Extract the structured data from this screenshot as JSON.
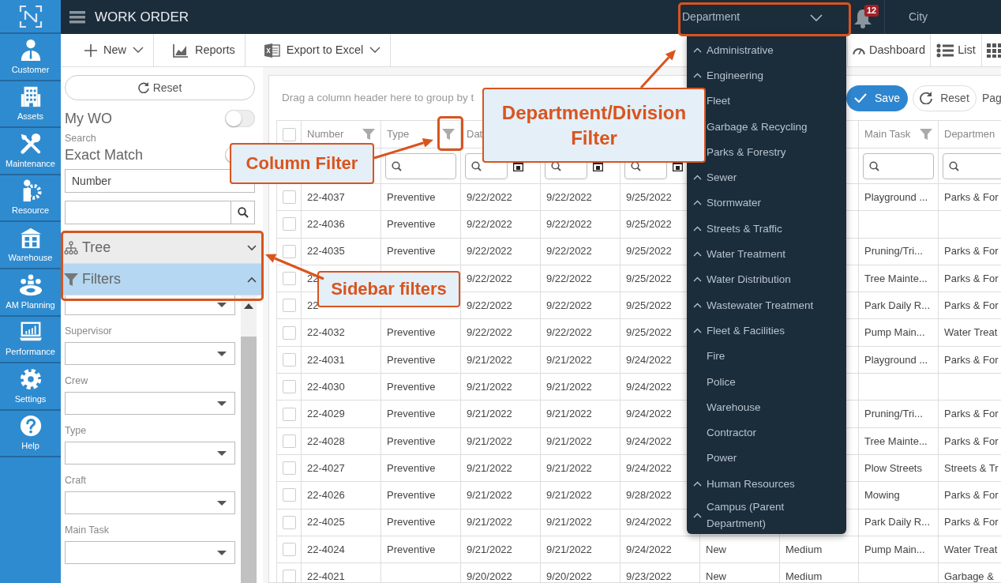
{
  "rail": {
    "items": [
      {
        "label": "Customer",
        "kind": "customer"
      },
      {
        "label": "Assets",
        "kind": "assets"
      },
      {
        "label": "Maintenance",
        "kind": "maintenance"
      },
      {
        "label": "Resource",
        "kind": "resource"
      },
      {
        "label": "Warehouse",
        "kind": "warehouse"
      },
      {
        "label": "AM Planning",
        "kind": "planning"
      },
      {
        "label": "Performance",
        "kind": "performance"
      },
      {
        "label": "Settings",
        "kind": "settings"
      },
      {
        "label": "Help",
        "kind": "help"
      }
    ]
  },
  "app_bar": {
    "title": "WORK ORDER",
    "department": {
      "label": "Department",
      "expanded": true
    },
    "notifications": "12",
    "city": "City"
  },
  "toolbar": {
    "left": [
      {
        "kind": "new",
        "label": "New",
        "caret": true
      },
      {
        "kind": "reports",
        "label": "Reports",
        "caret": false
      },
      {
        "kind": "export",
        "label": "Export to Excel",
        "caret": true
      }
    ],
    "right": [
      {
        "kind": "dashboard",
        "label": "Dashboard"
      },
      {
        "kind": "list",
        "label": "List"
      },
      {
        "kind": "grid"
      }
    ]
  },
  "sidebar": {
    "reset": "Reset",
    "my_wo": {
      "label": "My WO",
      "on": false
    },
    "search_label": "Search",
    "exact_match": {
      "label": "Exact Match",
      "on": false
    },
    "search_by": "Number",
    "sections": [
      {
        "label": "Tree",
        "kind": "tree",
        "expanded": false
      },
      {
        "label": "Filters",
        "kind": "filter",
        "expanded": true
      }
    ],
    "filters": [
      {
        "kind": "select"
      },
      {
        "kind": "select",
        "label": "Supervisor"
      },
      {
        "kind": "select",
        "label": "Crew"
      },
      {
        "kind": "select",
        "label": "Type"
      },
      {
        "kind": "select",
        "label": "Craft"
      },
      {
        "kind": "select",
        "label": "Main Task"
      }
    ]
  },
  "grid": {
    "group_hint": "Drag a column header here to group by t",
    "save": "Save",
    "reset": "Reset",
    "pager": "Pag",
    "select_all": {
      "checked": false
    },
    "columns": [
      {
        "kind": "plain",
        "label": "Number",
        "filter_icon": true
      },
      {
        "kind": "search",
        "label": "Type",
        "filter_icon": true
      },
      {
        "kind": "date",
        "label": "Dat",
        "filter_icon": false
      },
      {
        "kind": "date"
      },
      {
        "kind": "date"
      },
      {
        "kind": "plain"
      },
      {
        "kind": "plain"
      },
      {
        "kind": "search",
        "label": "Main Task",
        "filter_icon": true
      },
      {
        "kind": "search",
        "label": "Departmen",
        "filter_icon": false
      }
    ],
    "rows": [
      {
        "checked": false,
        "cells": [
          "22-4037",
          "Preventive",
          "9/22/2022",
          "9/22/2022",
          "9/25/2022",
          null,
          null,
          "Playground ...",
          "Parks & For"
        ]
      },
      {
        "checked": false,
        "cells": [
          "22-4036",
          "Preventive",
          "9/22/2022",
          "9/22/2022",
          "9/25/2022",
          null,
          null,
          null,
          null
        ]
      },
      {
        "checked": false,
        "cells": [
          "22-4035",
          "Preventive",
          "9/22/2022",
          "9/22/2022",
          "9/25/2022",
          null,
          null,
          "Pruning/Tri...",
          "Parks & For"
        ]
      },
      {
        "checked": false,
        "cells": [
          "22",
          null,
          "9/22/2022",
          "9/22/2022",
          "9/25/2022",
          null,
          null,
          "Tree Mainte...",
          "Parks & For"
        ]
      },
      {
        "checked": false,
        "cells": [
          "22",
          null,
          "9/22/2022",
          "9/22/2022",
          "9/25/2022",
          null,
          null,
          "Park Daily R...",
          "Parks & For"
        ]
      },
      {
        "checked": false,
        "cells": [
          "22-4032",
          "Preventive",
          "9/22/2022",
          "9/22/2022",
          "9/25/2022",
          null,
          null,
          "Pump Main...",
          "Water Treat"
        ]
      },
      {
        "checked": false,
        "cells": [
          "22-4031",
          "Preventive",
          "9/21/2022",
          "9/21/2022",
          "9/24/2022",
          null,
          null,
          "Playground ...",
          "Parks & For"
        ]
      },
      {
        "checked": false,
        "cells": [
          "22-4030",
          "Preventive",
          "9/21/2022",
          "9/21/2022",
          "9/24/2022",
          null,
          null,
          null,
          null
        ]
      },
      {
        "checked": false,
        "cells": [
          "22-4029",
          "Preventive",
          "9/21/2022",
          "9/21/2022",
          "9/24/2022",
          null,
          null,
          "Pruning/Tri...",
          "Parks & For"
        ]
      },
      {
        "checked": false,
        "cells": [
          "22-4028",
          "Preventive",
          "9/21/2022",
          "9/21/2022",
          "9/24/2022",
          null,
          null,
          "Tree Mainte...",
          "Parks & For"
        ]
      },
      {
        "checked": false,
        "cells": [
          "22-4027",
          "Preventive",
          "9/21/2022",
          "9/21/2022",
          "9/24/2022",
          null,
          null,
          "Plow Streets",
          "Streets & Tr"
        ]
      },
      {
        "checked": false,
        "cells": [
          "22-4026",
          "Preventive",
          "9/21/2022",
          "9/21/2022",
          "9/28/2022",
          null,
          null,
          "Mowing",
          "Parks & For"
        ]
      },
      {
        "checked": false,
        "cells": [
          "22-4025",
          "Preventive",
          "9/21/2022",
          "9/21/2022",
          "9/24/2022",
          null,
          null,
          "Park Daily R...",
          "Parks & For"
        ]
      },
      {
        "checked": false,
        "cells": [
          "22-4024",
          "Preventive",
          "9/21/2022",
          "9/21/2022",
          "9/24/2022",
          "New",
          "Medium",
          "Pump Main...",
          "Water Treat"
        ]
      },
      {
        "checked": false,
        "cells": [
          "22-4021",
          null,
          "9/20/2022",
          "9/20/2022",
          "9/23/2022",
          "New",
          "Medium",
          null,
          "Garbage &"
        ]
      }
    ]
  },
  "department_menu": {
    "items": [
      {
        "label": "Administrative",
        "expandable": true
      },
      {
        "label": "Engineering",
        "expandable": true,
        "children": [
          {
            "label": "Fleet"
          },
          {
            "label": "Garbage & Recycling"
          },
          {
            "label": "Parks & Forestry"
          }
        ]
      },
      {
        "label": "Sewer",
        "expandable": true
      },
      {
        "label": "Stormwater",
        "expandable": true
      },
      {
        "label": "Streets & Traffic",
        "expandable": true
      },
      {
        "label": "Water Treatment",
        "expandable": true
      },
      {
        "label": "Water Distribution",
        "expandable": true
      },
      {
        "label": "Wastewater Treatment",
        "expandable": true
      },
      {
        "label": "Fleet & Facilities",
        "expandable": true,
        "children": [
          {
            "label": "Fire"
          },
          {
            "label": "Police"
          },
          {
            "label": "Warehouse"
          },
          {
            "label": "Contractor"
          },
          {
            "label": "Power"
          }
        ]
      },
      {
        "label": "Human Resources",
        "expandable": true
      },
      {
        "label": "Campus (Parent Department)",
        "expandable": true
      }
    ]
  },
  "annotations": [
    {
      "text": "Department/Division Filter"
    },
    {
      "text": "Column Filter"
    },
    {
      "text": "Sidebar filters"
    }
  ]
}
